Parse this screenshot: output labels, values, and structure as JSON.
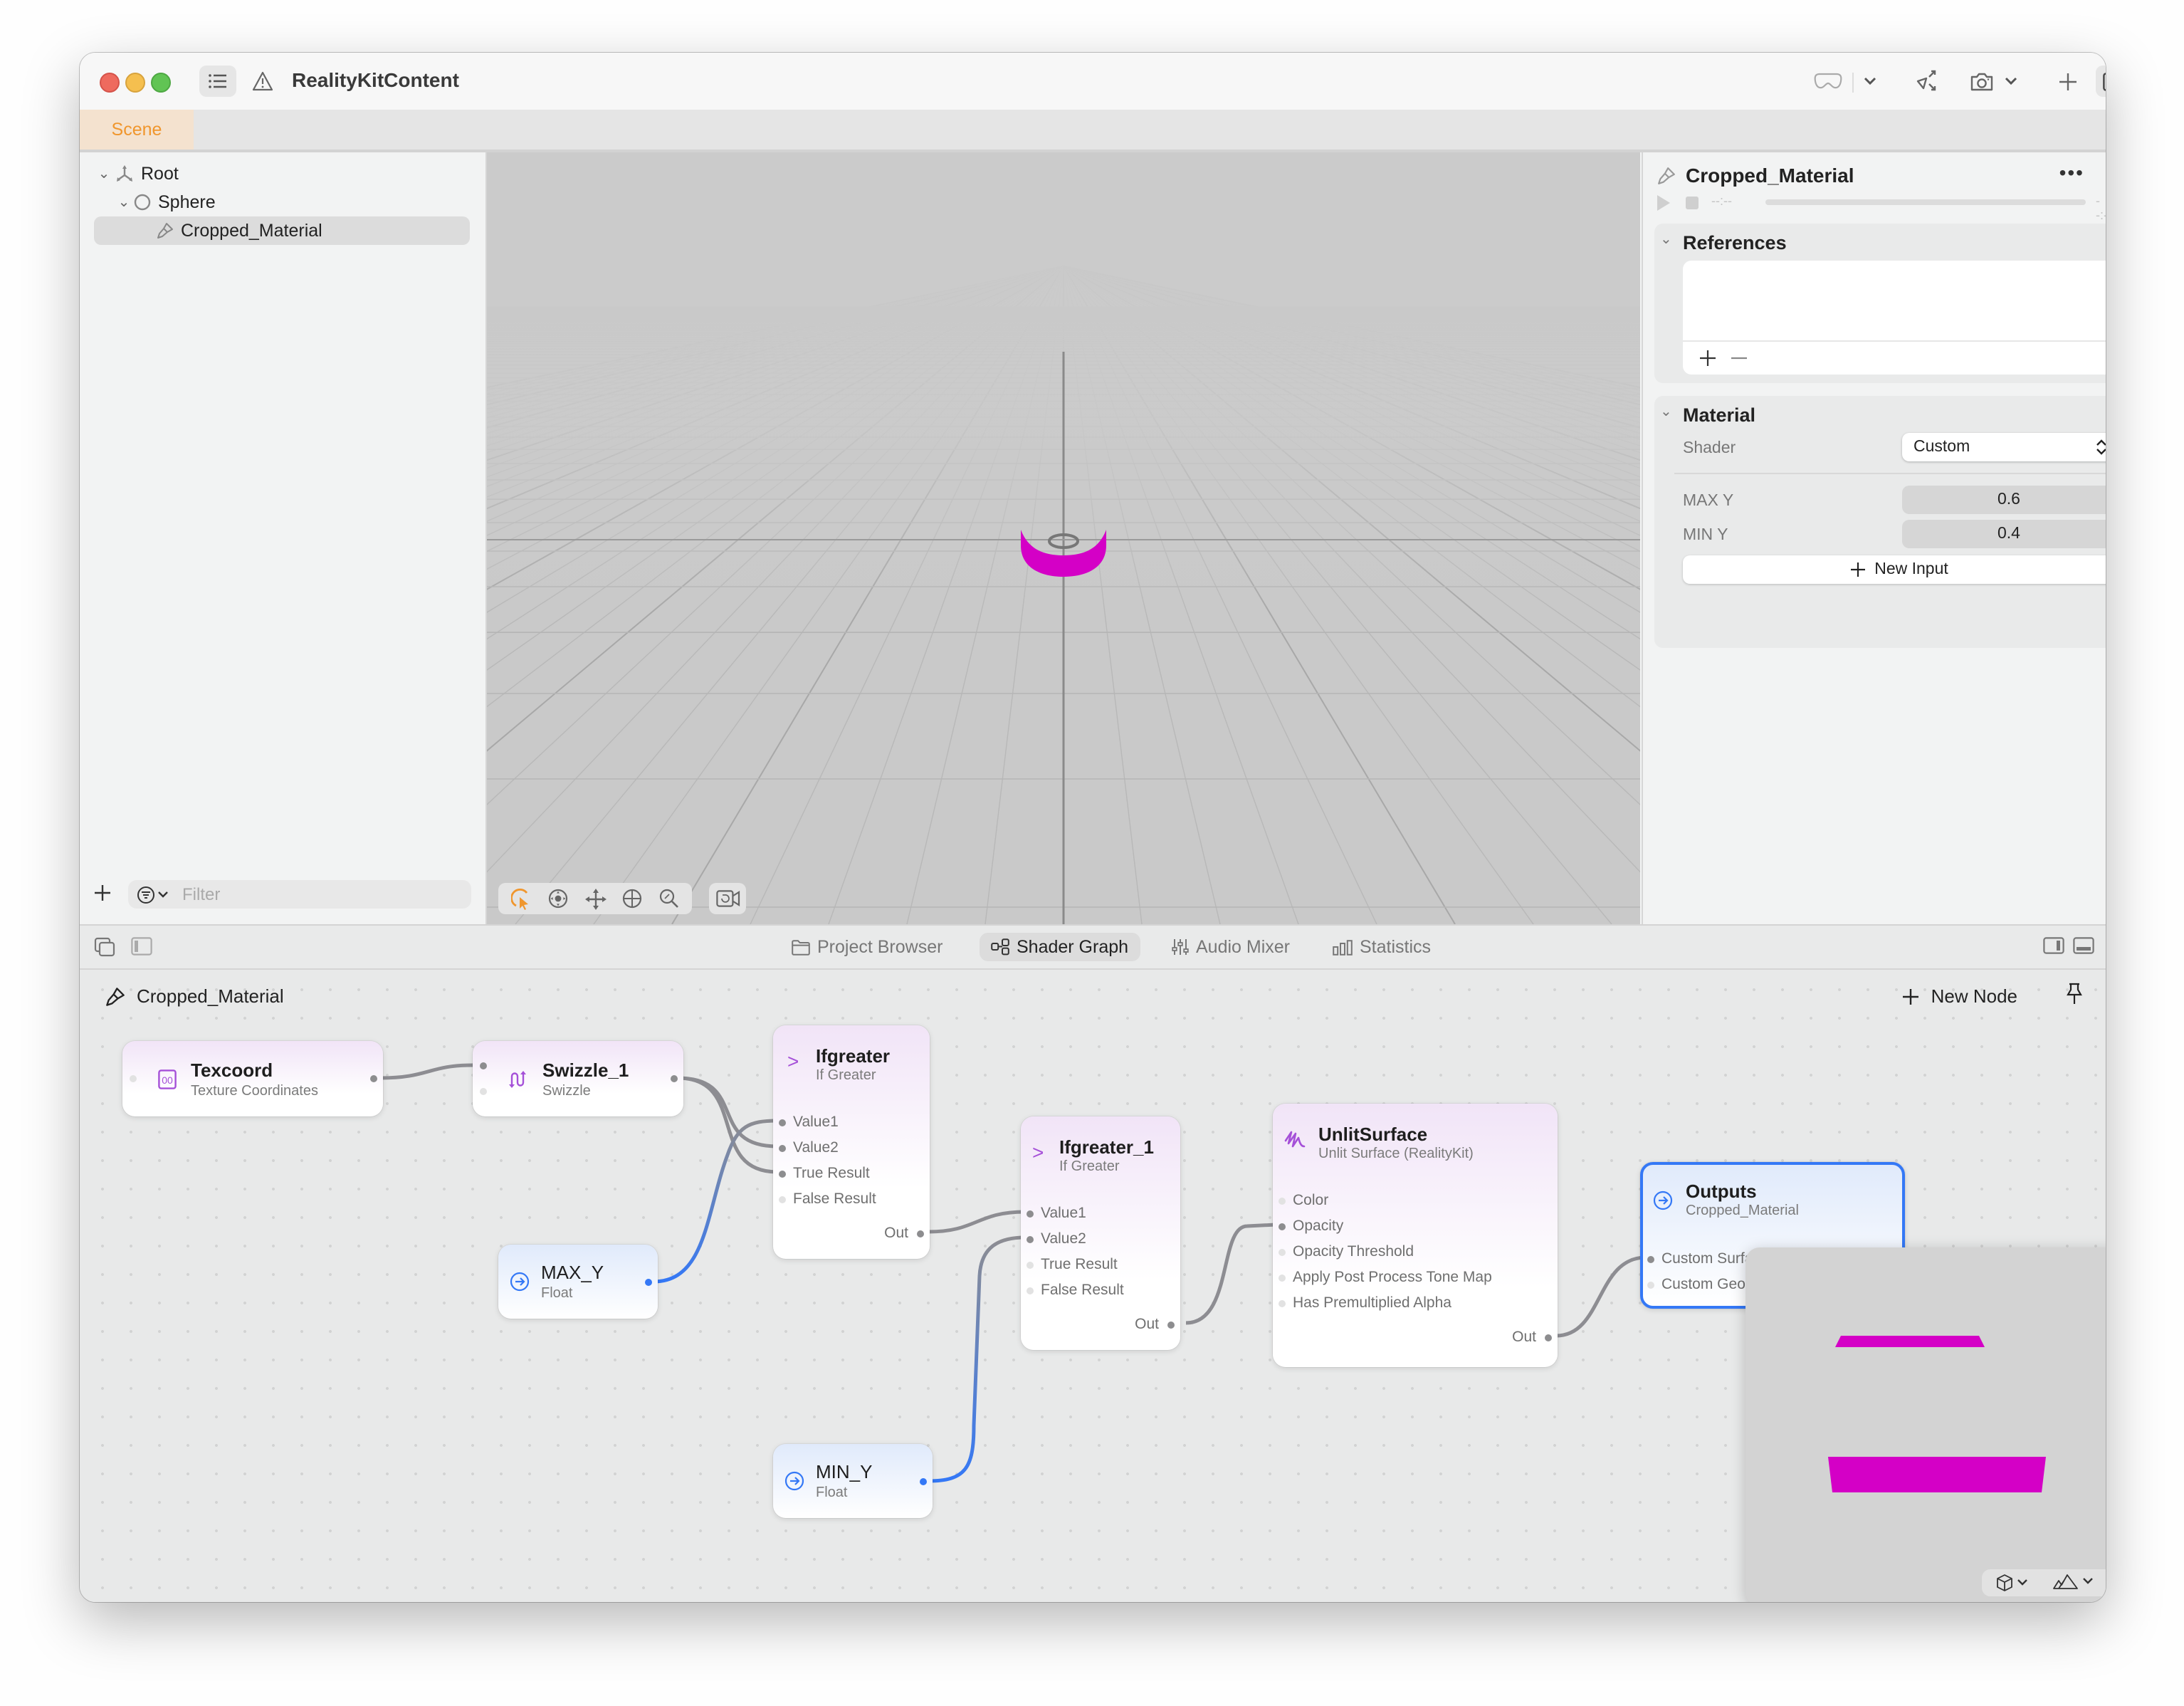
{
  "window": {
    "title": "RealityKitContent",
    "scene_tab": "Scene"
  },
  "hierarchy": {
    "items": [
      {
        "label": "Root",
        "icon": "transform-axes-icon",
        "expanded": true
      },
      {
        "label": "Sphere",
        "icon": "sphere-icon",
        "expanded": true
      },
      {
        "label": "Cropped_Material",
        "icon": "material-brush-icon",
        "selected": true
      }
    ],
    "filter_placeholder": "Filter"
  },
  "inspector": {
    "title": "Cropped_Material",
    "time_start": "--:--",
    "time_end": "--:--",
    "references": {
      "heading": "References"
    },
    "material": {
      "heading": "Material",
      "shader_label": "Shader",
      "shader_value": "Custom",
      "inputs": [
        {
          "label": "MAX Y",
          "value": "0.6"
        },
        {
          "label": "MIN Y",
          "value": "0.4"
        }
      ],
      "new_input_label": "New Input"
    }
  },
  "bottom_tabs": [
    {
      "label": "Project Browser",
      "active": false
    },
    {
      "label": "Shader Graph",
      "active": true
    },
    {
      "label": "Audio Mixer",
      "active": false
    },
    {
      "label": "Statistics",
      "active": false
    }
  ],
  "graph": {
    "title": "Cropped_Material",
    "new_node_label": "New Node",
    "nodes": {
      "texcoord": {
        "title": "Texcoord",
        "subtitle": "Texture Coordinates"
      },
      "swizzle": {
        "title": "Swizzle_1",
        "subtitle": "Swizzle"
      },
      "ifgreater": {
        "title": "Ifgreater",
        "subtitle": "If Greater",
        "inputs": [
          "Value1",
          "Value2",
          "True Result",
          "False Result"
        ],
        "output": "Out"
      },
      "ifgreater_1": {
        "title": "Ifgreater_1",
        "subtitle": "If Greater",
        "inputs": [
          "Value1",
          "Value2",
          "True Result",
          "False Result"
        ],
        "output": "Out"
      },
      "max_y": {
        "title": "MAX_Y",
        "subtitle": "Float"
      },
      "min_y": {
        "title": "MIN_Y",
        "subtitle": "Float"
      },
      "unlit": {
        "title": "UnlitSurface",
        "subtitle": "Unlit Surface (RealityKit)",
        "inputs": [
          "Color",
          "Opacity",
          "Opacity Threshold",
          "Apply Post Process Tone Map",
          "Has Premultiplied Alpha"
        ],
        "output": "Out"
      },
      "outputs": {
        "title": "Outputs",
        "subtitle": "Cropped_Material",
        "inputs": [
          "Custom Surface",
          "Custom Geometry Modifier"
        ]
      }
    }
  },
  "colors": {
    "accent_orange": "#f0962d",
    "selection_blue": "#3478f6",
    "node_purple": "#a550d8",
    "material_magenta": "#d400c6"
  }
}
